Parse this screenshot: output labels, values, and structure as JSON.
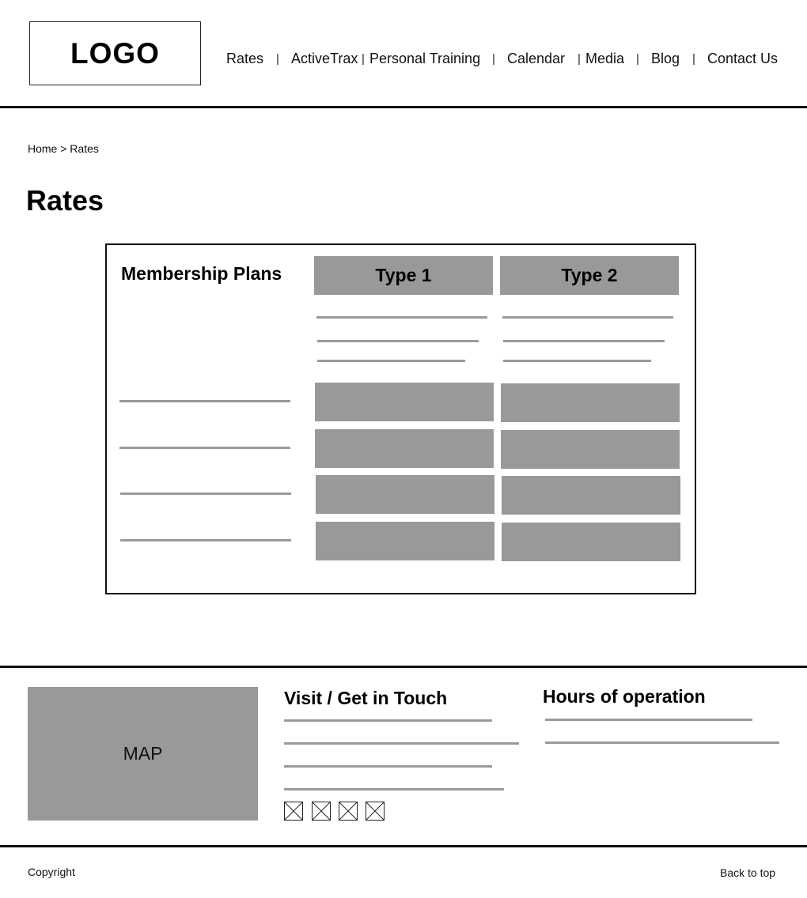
{
  "header": {
    "logo_text": "LOGO",
    "nav": {
      "rates": "Rates",
      "activetrax": "ActiveTrax",
      "personal_training": "Personal Training",
      "calendar": "Calendar",
      "media": "Media",
      "blog": "Blog",
      "contact_us": "Contact Us",
      "separator": "|"
    }
  },
  "breadcrumb": {
    "text": "Home > Rates"
  },
  "main": {
    "title": "Rates",
    "table": {
      "heading": "Membership Plans",
      "columns": [
        "Type 1",
        "Type 2"
      ]
    }
  },
  "footer": {
    "map_label": "MAP",
    "visit_heading": "Visit / Get in Touch",
    "hours_heading": "Hours of operation",
    "social_icons": [
      "image-placeholder-icon",
      "image-placeholder-icon",
      "image-placeholder-icon",
      "image-placeholder-icon"
    ],
    "copyright": "Copyright",
    "back_to_top": "Back to top"
  },
  "colors": {
    "placeholder_gray": "#999999",
    "rule": "#111111"
  }
}
